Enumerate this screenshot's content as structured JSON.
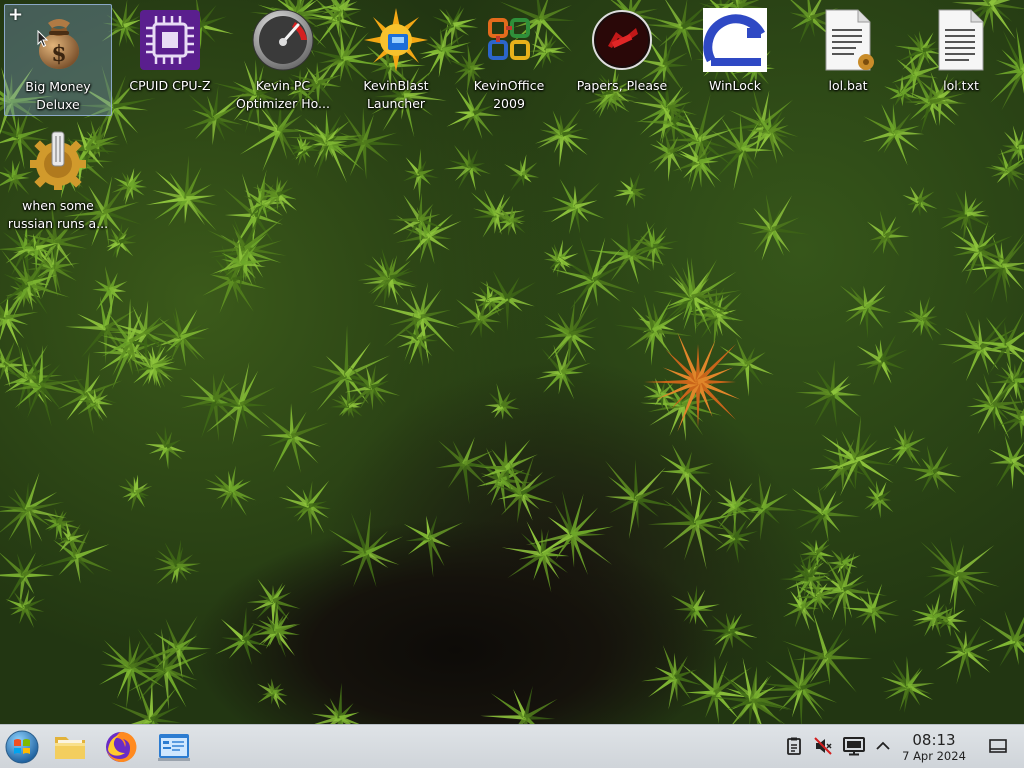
{
  "desktop": {
    "icons": [
      {
        "label": "Big Money\nDeluxe",
        "icon": "money-bag-icon",
        "selected": true
      },
      {
        "label": "CPUID CPU-Z",
        "icon": "cpu-chip-icon"
      },
      {
        "label": "Kevin PC\nOptimizer Ho...",
        "icon": "speedometer-gauge-icon"
      },
      {
        "label": "KevinBlast\nLauncher",
        "icon": "sun-burst-icon"
      },
      {
        "label": "KevinOffice\n2009",
        "icon": "office-logo-icon"
      },
      {
        "label": "Papers, Please",
        "icon": "red-seal-icon"
      },
      {
        "label": "WinLock",
        "icon": "winlock-arc-icon"
      },
      {
        "label": "lol.bat",
        "icon": "batch-file-icon"
      },
      {
        "label": "lol.txt",
        "icon": "text-file-icon"
      },
      {
        "label": "when some\nrussian runs a...",
        "icon": "gear-script-icon"
      }
    ]
  },
  "taskbar": {
    "start_button": "start-orb-icon",
    "pinned": [
      "file-manager-icon",
      "firefox-icon",
      "control-panel-icon"
    ],
    "tray": [
      "clipboard-icon",
      "volume-muted-icon",
      "display-icon",
      "expand-arrow-icon"
    ],
    "clock": {
      "time": "08:13",
      "date": "7 Apr 2024"
    },
    "show_desktop": "show-desktop-icon"
  },
  "colors": {
    "taskbar_bg": "#d7dbe0",
    "selection": "#7896be",
    "wallpaper_base": "#223612"
  }
}
